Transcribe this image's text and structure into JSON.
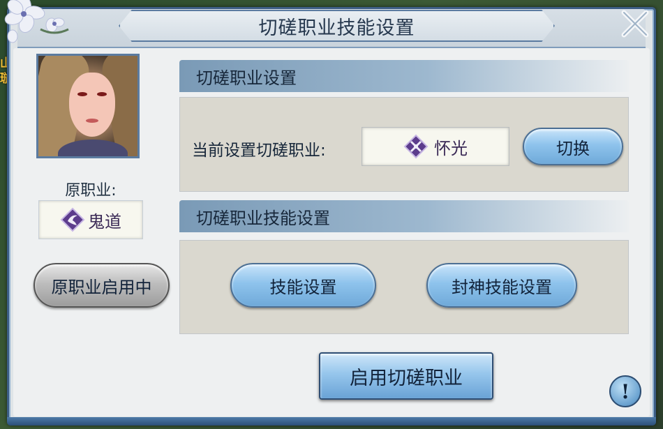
{
  "background": {
    "side_text": "山\n璇"
  },
  "dialog": {
    "title": "切磋职业技能设置"
  },
  "original_class": {
    "label": "原职业:",
    "class_name": "鬼道",
    "status_button": "原职业启用中"
  },
  "spar_class_section": {
    "header": "切磋职业设置",
    "current_label": "当前设置切磋职业:",
    "current_class": "怀光",
    "switch_button": "切换"
  },
  "spar_skill_section": {
    "header": "切磋职业技能设置",
    "skill_settings_button": "技能设置",
    "fengshen_skill_button": "封神技能设置"
  },
  "enable_button": "启用切磋职业",
  "help_button": "!",
  "colors": {
    "accent_blue": "#8ec3ec",
    "frame_border": "#3c5d85",
    "class_icon_purple": "#5c3c8c"
  }
}
